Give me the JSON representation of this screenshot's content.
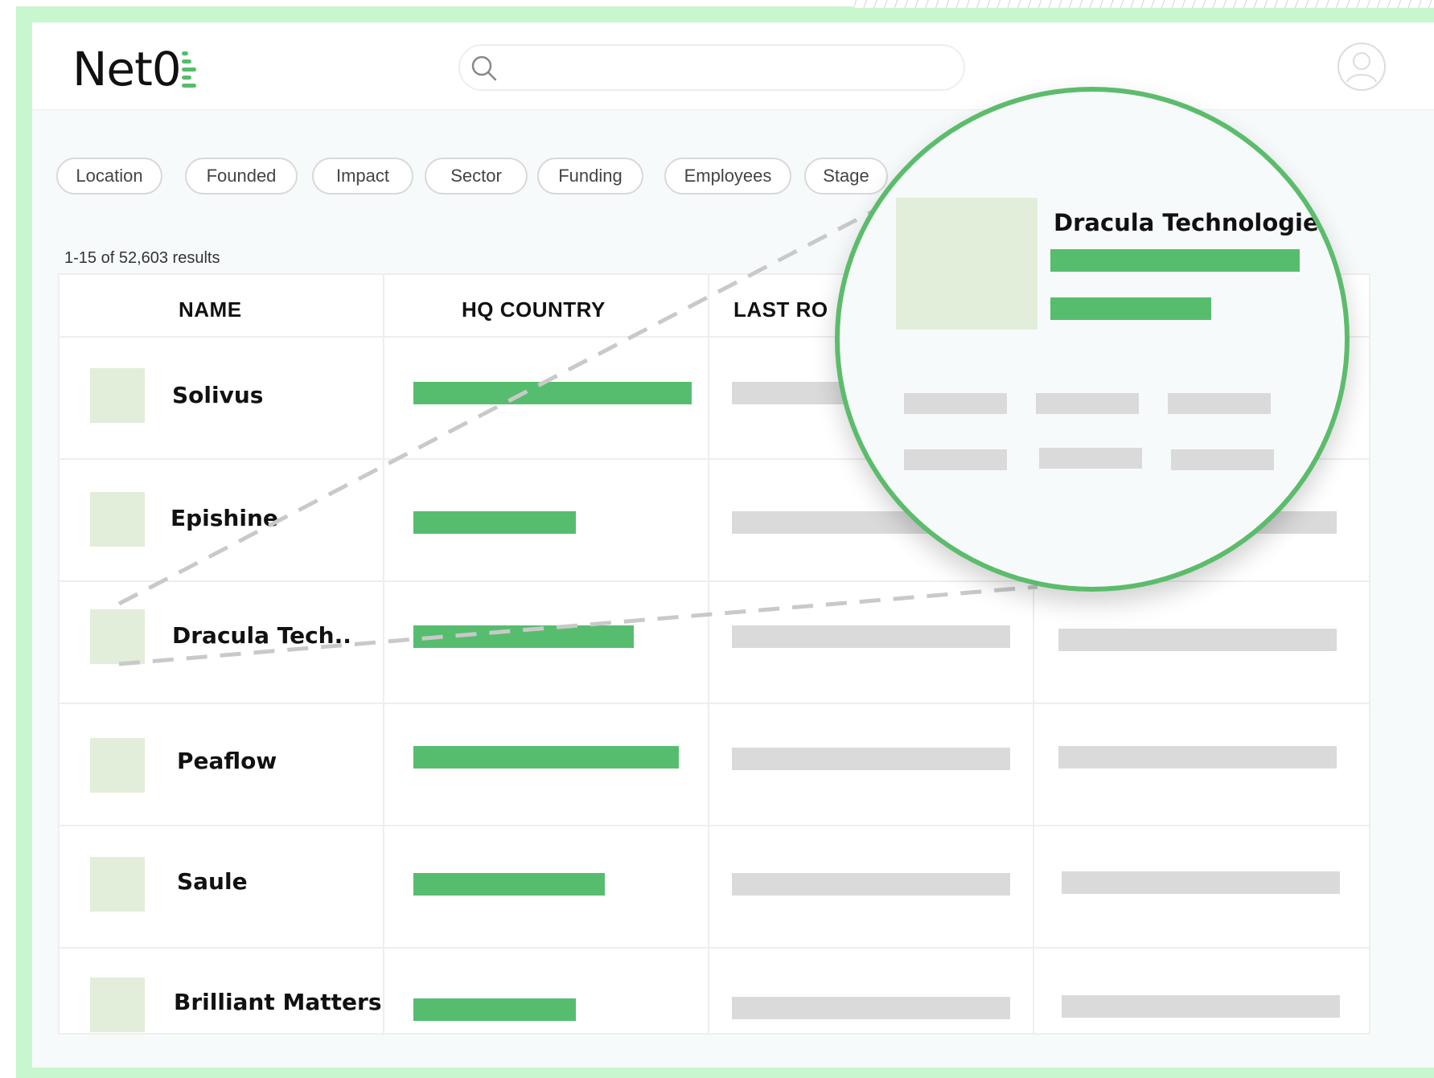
{
  "app": {
    "logo_text": "Net0"
  },
  "search": {
    "placeholder": ""
  },
  "filters": [
    {
      "label": "Location"
    },
    {
      "label": "Founded"
    },
    {
      "label": "Impact"
    },
    {
      "label": "Sector"
    },
    {
      "label": "Funding"
    },
    {
      "label": "Employees"
    },
    {
      "label": "Stage"
    }
  ],
  "results": {
    "text": "1-15 of 52,603 results"
  },
  "table": {
    "columns": [
      {
        "label": "NAME"
      },
      {
        "label": "HQ COUNTRY"
      },
      {
        "label": "LAST RO"
      },
      {
        "label": ""
      }
    ],
    "rows": [
      {
        "name": "Solivus"
      },
      {
        "name": "Epishine"
      },
      {
        "name": "Dracula Tech.."
      },
      {
        "name": "Peaflow"
      },
      {
        "name": "Saule"
      },
      {
        "name": "Brilliant Matters"
      }
    ]
  },
  "magnifier": {
    "title": "Dracula Technologies"
  },
  "colors": {
    "accent_green": "#57bd6e",
    "frame_green": "#c8f6ce",
    "thumb_green": "#e2eed9",
    "placeholder_grey": "#dadada"
  }
}
